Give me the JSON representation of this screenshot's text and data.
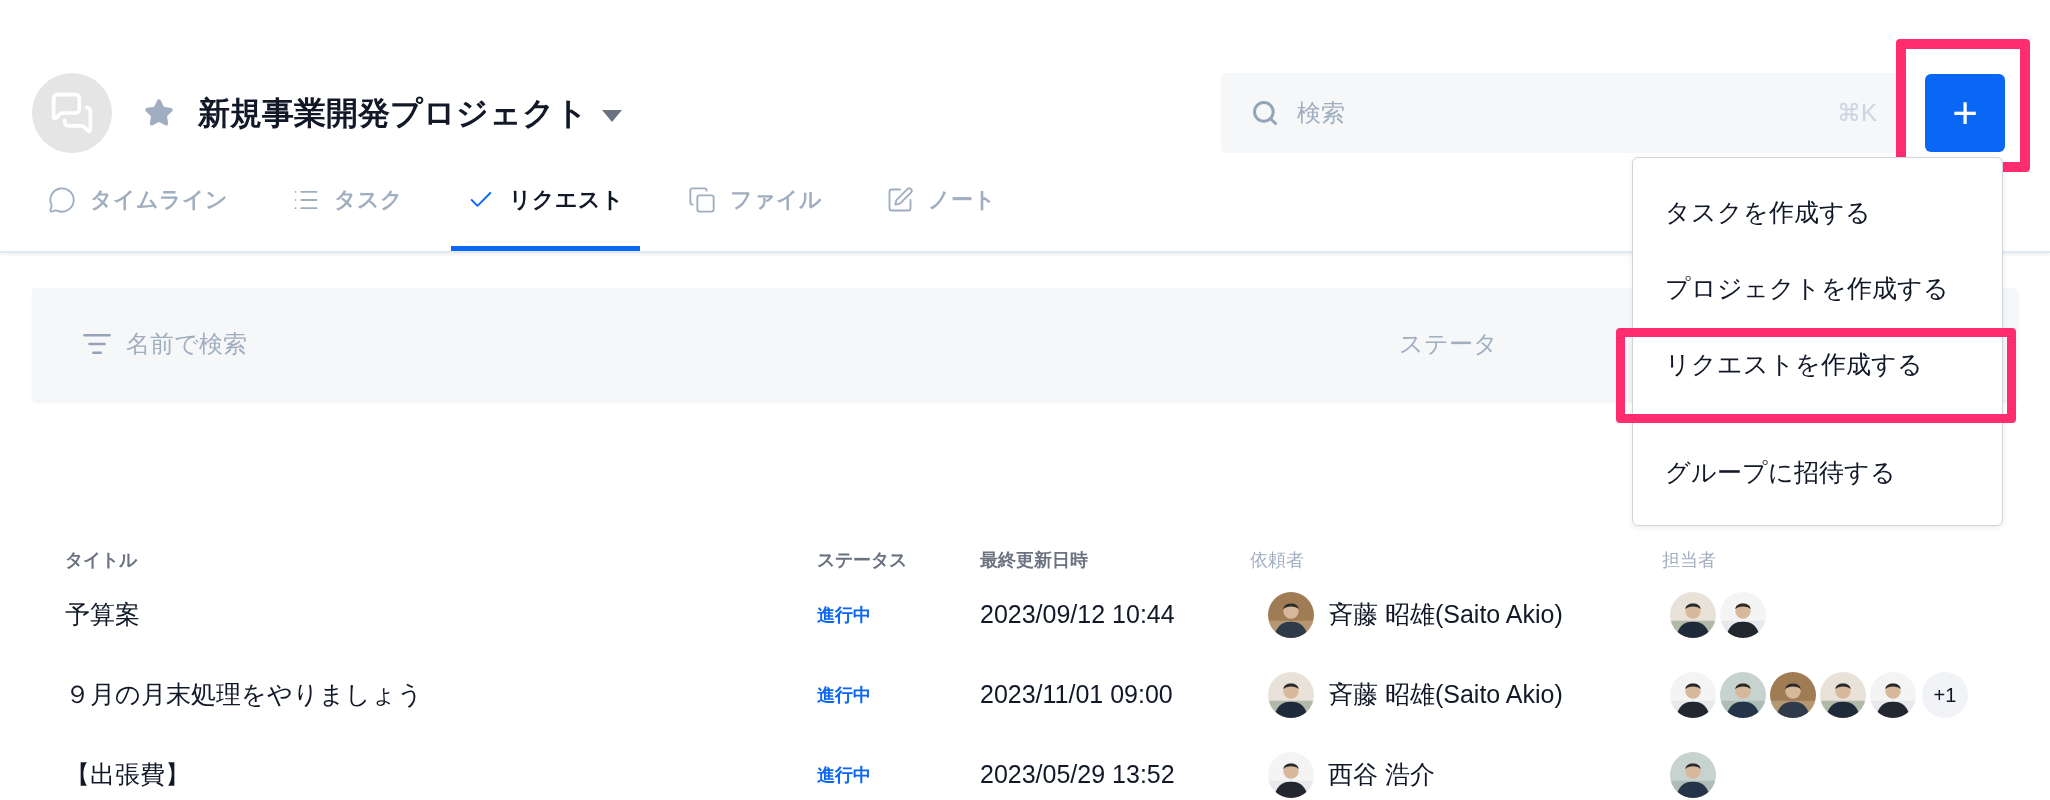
{
  "project": {
    "title": "新規事業開発プロジェクト",
    "starred": true
  },
  "search": {
    "placeholder": "検索",
    "shortcut": "⌘K"
  },
  "create_button": {
    "label": "+",
    "highlighted": true
  },
  "tabs": [
    {
      "label": "タイムライン",
      "selected": false
    },
    {
      "label": "タスク",
      "selected": false
    },
    {
      "label": "リクエスト",
      "selected": true
    },
    {
      "label": "ファイル",
      "selected": false
    },
    {
      "label": "ノート",
      "selected": false
    }
  ],
  "filter": {
    "placeholder": "名前で検索",
    "status_label": "ステータ"
  },
  "menu": {
    "sections": [
      {
        "items": [
          {
            "label": "タスクを作成する",
            "highlighted": false
          },
          {
            "label": "プロジェクトを作成する",
            "highlighted": false
          },
          {
            "label": "リクエストを作成する",
            "highlighted": true
          }
        ]
      },
      {
        "items": [
          {
            "label": "グループに招待する",
            "highlighted": false
          }
        ]
      }
    ]
  },
  "table": {
    "columns": [
      {
        "label": "タイトル",
        "kind": "strong"
      },
      {
        "label": "ステータス",
        "kind": "strong"
      },
      {
        "label": "最終更新日時",
        "kind": "strong"
      },
      {
        "label": "依頼者",
        "kind": "light"
      },
      {
        "label": "担当者",
        "kind": "light"
      }
    ],
    "rows": [
      {
        "title": "予算案",
        "status": "進行中",
        "updated": "2023/09/12 10:44",
        "requester": {
          "name": "斉藤 昭雄(Saito Akio)"
        }
      },
      {
        "title": "９月の月末処理をやりましょう",
        "status": "進行中",
        "updated": "2023/11/01 09:00",
        "requester": {
          "name": "斉藤 昭雄(Saito Akio)"
        },
        "more": "+1"
      },
      {
        "title": "【出張費】",
        "status": "進行中",
        "updated": "2023/05/29 13:52",
        "requester": {
          "name": "西谷 浩介"
        }
      }
    ]
  }
}
